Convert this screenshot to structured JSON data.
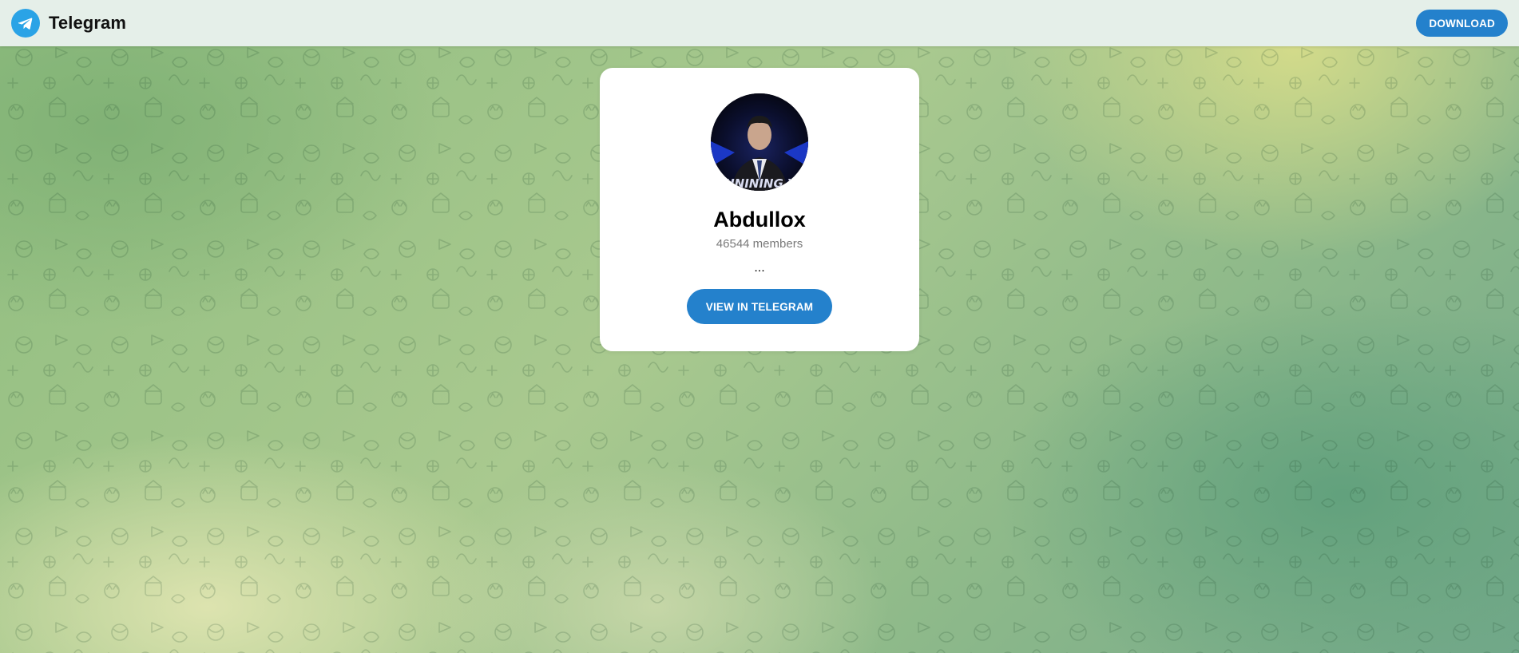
{
  "topbar": {
    "brand_name": "Telegram",
    "logo_icon": "telegram-paper-plane-icon",
    "download_label": "DOWNLOAD"
  },
  "channel": {
    "title": "Abdullox",
    "members": "46544 members",
    "description": "...",
    "view_button_label": "VIEW IN TELEGRAM",
    "avatar_caption": "HUNINING YA"
  },
  "colors": {
    "accent": "#2481cc",
    "logo": "#2aa3e6",
    "topbar_bg": "#e5efe9",
    "card_bg": "#ffffff"
  }
}
